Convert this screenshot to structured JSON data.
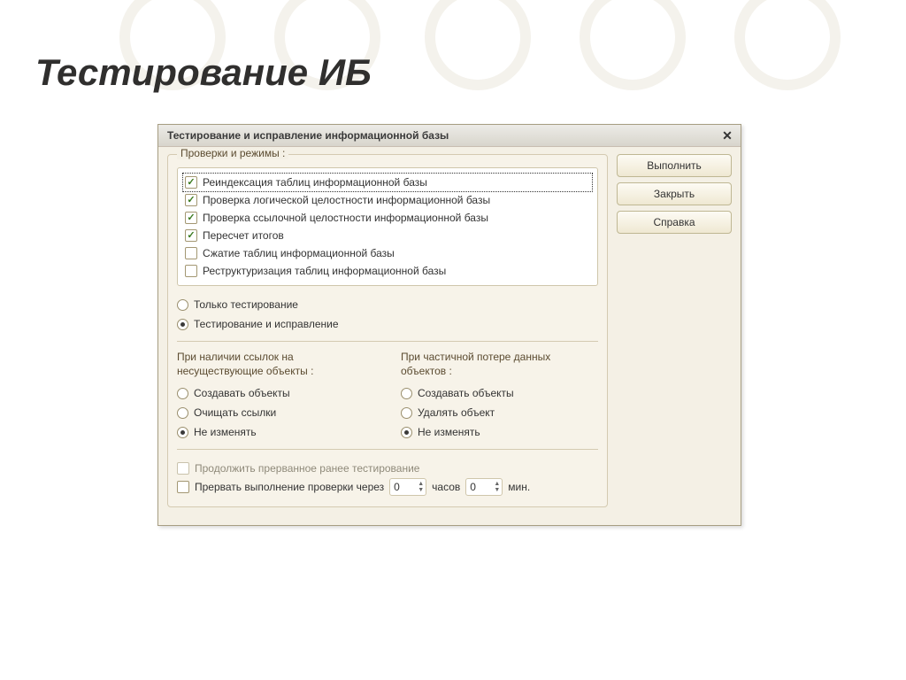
{
  "slide": {
    "title": "Тестирование ИБ"
  },
  "dialog": {
    "title": "Тестирование и исправление информационной базы",
    "buttons": {
      "execute": "Выполнить",
      "close": "Закрыть",
      "help": "Справка"
    },
    "checks_group_title": "Проверки и режимы :",
    "checks": [
      {
        "label": "Реиндексация таблиц информационной базы",
        "checked": true,
        "focused": true
      },
      {
        "label": "Проверка логической целостности информационной базы",
        "checked": true
      },
      {
        "label": "Проверка ссылочной целостности информационной базы",
        "checked": true
      },
      {
        "label": "Пересчет итогов",
        "checked": true
      },
      {
        "label": "Сжатие таблиц информационной базы",
        "checked": false
      },
      {
        "label": "Реструктуризация таблиц информационной базы",
        "checked": false
      }
    ],
    "mode_options": [
      {
        "label": "Только тестирование",
        "selected": false
      },
      {
        "label": "Тестирование и исправление",
        "selected": true
      }
    ],
    "ref_missing": {
      "heading": "При наличии ссылок на несуществующие объекты :",
      "options": [
        {
          "label": "Создавать объекты",
          "selected": false
        },
        {
          "label": "Очищать ссылки",
          "selected": false
        },
        {
          "label": "Не изменять",
          "selected": true
        }
      ]
    },
    "partial_loss": {
      "heading": "При частичной потере данных объектов :",
      "options": [
        {
          "label": "Создавать объекты",
          "selected": false
        },
        {
          "label": "Удалять объект",
          "selected": false
        },
        {
          "label": "Не изменять",
          "selected": true
        }
      ]
    },
    "resume": {
      "label": "Продолжить прерванное ранее тестирование",
      "checked": false,
      "enabled": false
    },
    "timeout": {
      "label_prefix": "Прервать выполнение проверки через",
      "hours_value": "0",
      "hours_unit": "часов",
      "minutes_value": "0",
      "minutes_unit": "мин.",
      "checked": false
    }
  }
}
